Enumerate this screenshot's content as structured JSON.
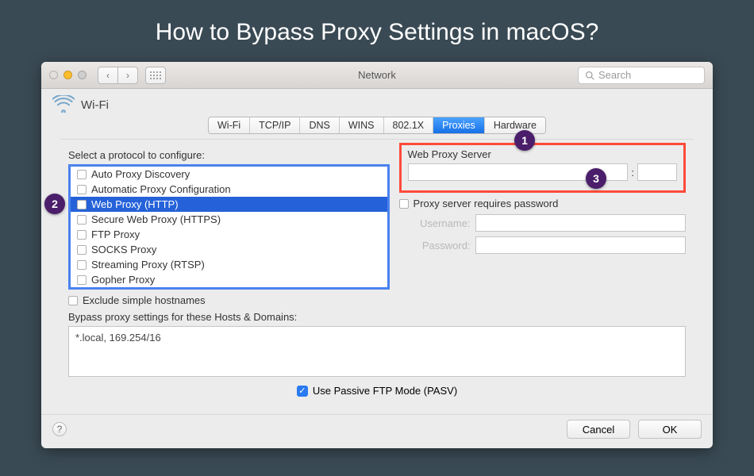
{
  "page": {
    "title": "How to Bypass Proxy Settings in macOS?"
  },
  "window": {
    "title": "Network",
    "search_placeholder": "Search",
    "traffic_colors": {
      "close": "#ff5f57",
      "min": "#ffbd2e",
      "max": "#cfcfcf"
    }
  },
  "header": {
    "interface_label": "Wi-Fi"
  },
  "tabs": [
    "Wi-Fi",
    "TCP/IP",
    "DNS",
    "WINS",
    "802.1X",
    "Proxies",
    "Hardware"
  ],
  "tabs_active_index": 5,
  "proxy": {
    "select_label": "Select a protocol to configure:",
    "protocols": [
      {
        "label": "Auto Proxy Discovery",
        "checked": false,
        "selected": false
      },
      {
        "label": "Automatic Proxy Configuration",
        "checked": false,
        "selected": false
      },
      {
        "label": "Web Proxy (HTTP)",
        "checked": false,
        "selected": true
      },
      {
        "label": "Secure Web Proxy (HTTPS)",
        "checked": false,
        "selected": false
      },
      {
        "label": "FTP Proxy",
        "checked": false,
        "selected": false
      },
      {
        "label": "SOCKS Proxy",
        "checked": false,
        "selected": false
      },
      {
        "label": "Streaming Proxy (RTSP)",
        "checked": false,
        "selected": false
      },
      {
        "label": "Gopher Proxy",
        "checked": false,
        "selected": false
      }
    ],
    "server_section_label": "Web Proxy Server",
    "server_host": "",
    "server_port": "",
    "requires_password_label": "Proxy server requires password",
    "requires_password_checked": false,
    "username_label": "Username:",
    "username_value": "",
    "password_label": "Password:",
    "password_value": "",
    "exclude_simple_label": "Exclude simple hostnames",
    "exclude_simple_checked": false,
    "bypass_label": "Bypass proxy settings for these Hosts & Domains:",
    "bypass_value": "*.local, 169.254/16",
    "pasv_label": "Use Passive FTP Mode (PASV)",
    "pasv_checked": true
  },
  "footer": {
    "cancel": "Cancel",
    "ok": "OK"
  },
  "callouts": {
    "one": "1",
    "two": "2",
    "three": "3"
  }
}
